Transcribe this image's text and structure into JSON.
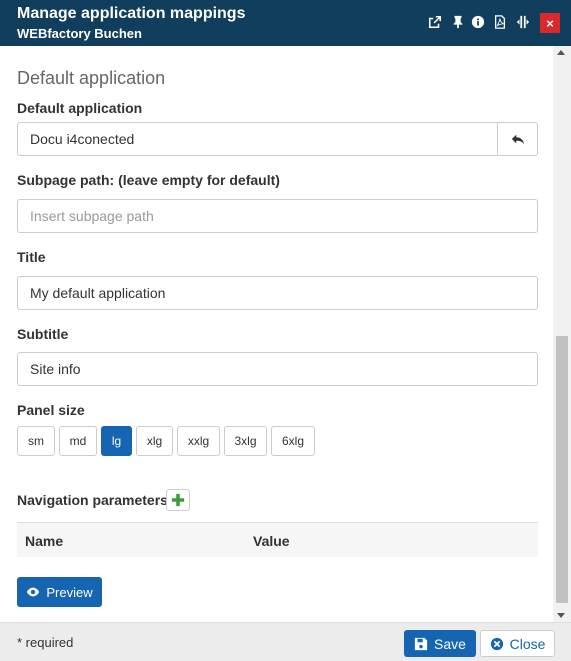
{
  "window": {
    "title": "Manage application mappings",
    "subtitle": "WEBfactory Buchen",
    "header_icons": [
      "external-link-icon",
      "pin-icon",
      "info-icon",
      "pdf-icon",
      "resize-icon"
    ],
    "close_label": "×",
    "colors": {
      "header": "#123e5e",
      "close": "#d9292b",
      "primary": "#1665b2"
    }
  },
  "form": {
    "section_title": "Default application",
    "default_app": {
      "label": "Default application",
      "value": "Docu i4conected"
    },
    "subpage": {
      "label": "Subpage path: (leave empty for default)",
      "placeholder": "Insert subpage path",
      "value": ""
    },
    "title_field": {
      "label": "Title",
      "value": "My default application"
    },
    "subtitle_field": {
      "label": "Subtitle",
      "value": "Site info"
    },
    "panel_size": {
      "label": "Panel size",
      "options": [
        "sm",
        "md",
        "lg",
        "xlg",
        "xxlg",
        "3xlg",
        "6xlg"
      ],
      "selected": "lg"
    },
    "navigation": {
      "label": "Navigation parameters",
      "columns": [
        "Name",
        "Value"
      ],
      "rows": []
    },
    "preview_label": "Preview"
  },
  "footer": {
    "required_note": "* required",
    "save_label": "Save",
    "close_label": "Close"
  }
}
